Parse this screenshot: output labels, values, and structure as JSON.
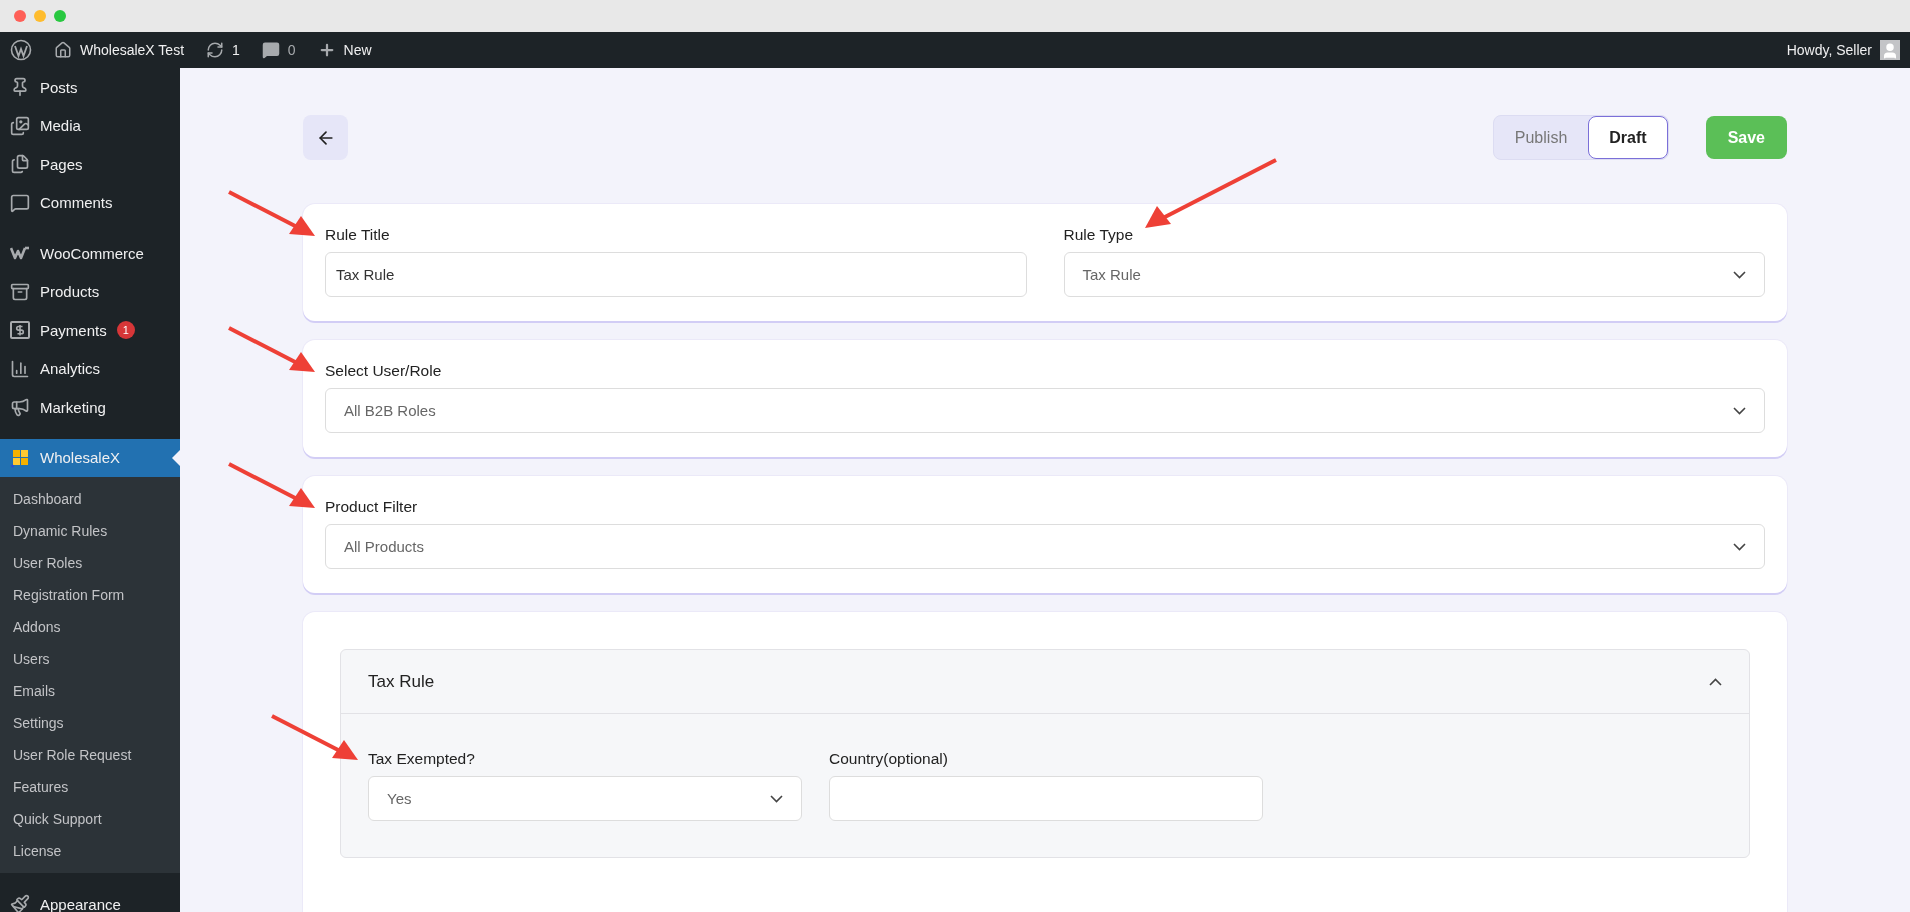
{
  "admin_bar": {
    "site_name": "WholesaleX Test",
    "updates": "1",
    "comments": "0",
    "new_label": "New",
    "greeting": "Howdy, Seller"
  },
  "sidebar": {
    "groups": [
      {
        "items": [
          {
            "kind": "posts",
            "label": "Posts",
            "selected": false
          },
          {
            "kind": "media",
            "label": "Media",
            "selected": false
          },
          {
            "kind": "pages",
            "label": "Pages",
            "selected": false
          },
          {
            "kind": "comments",
            "label": "Comments",
            "selected": false
          }
        ]
      },
      {
        "items": [
          {
            "kind": "woo",
            "label": "WooCommerce",
            "selected": false
          },
          {
            "kind": "products",
            "label": "Products",
            "selected": false
          },
          {
            "kind": "payments",
            "label": "Payments",
            "badge": "1",
            "selected": false
          },
          {
            "kind": "analytics",
            "label": "Analytics",
            "selected": false
          },
          {
            "kind": "marketing",
            "label": "Marketing",
            "selected": false
          }
        ]
      },
      {
        "items": [
          {
            "kind": "wholesalex",
            "label": "WholesaleX",
            "selected": true,
            "expanded": true,
            "children": [
              {
                "label": "Dashboard",
                "selected": false
              },
              {
                "label": "Dynamic Rules",
                "selected": false
              },
              {
                "label": "User Roles",
                "selected": false
              },
              {
                "label": "Registration Form",
                "selected": false
              },
              {
                "label": "Addons",
                "selected": false
              },
              {
                "label": "Users",
                "selected": false
              },
              {
                "label": "Emails",
                "selected": false
              },
              {
                "label": "Settings",
                "selected": false
              },
              {
                "label": "User Role Request",
                "selected": false
              },
              {
                "label": "Features",
                "selected": false
              },
              {
                "label": "Quick Support",
                "selected": false
              },
              {
                "label": "License",
                "selected": false
              }
            ]
          }
        ]
      },
      {
        "items": [
          {
            "kind": "appearance",
            "label": "Appearance",
            "selected": false
          }
        ]
      }
    ]
  },
  "header": {
    "status_toggle": [
      {
        "label": "Publish",
        "selected": false
      },
      {
        "label": "Draft",
        "selected": true
      }
    ],
    "save_label": "Save"
  },
  "cards": [
    {
      "fields": [
        {
          "kind": "text",
          "label": "Rule Title",
          "value": "Tax Rule",
          "arrow_from_left": true
        },
        {
          "kind": "select",
          "label": "Rule Type",
          "value": "Tax Rule",
          "arrow_from_right": true
        }
      ]
    },
    {
      "fields": [
        {
          "kind": "select",
          "label": "Select User/Role",
          "value": "All B2B Roles",
          "arrow_from_left": true
        }
      ]
    },
    {
      "fields": [
        {
          "kind": "select",
          "label": "Product Filter",
          "value": "All Products",
          "arrow_from_left": true
        }
      ]
    }
  ],
  "tax_panel": {
    "title": "Tax Rule",
    "expanded": true,
    "fields": [
      {
        "kind": "select",
        "label": "Tax Exempted?",
        "value": "Yes",
        "arrow_from_left": true
      },
      {
        "kind": "text",
        "label": "Country(optional)"
      }
    ]
  }
}
